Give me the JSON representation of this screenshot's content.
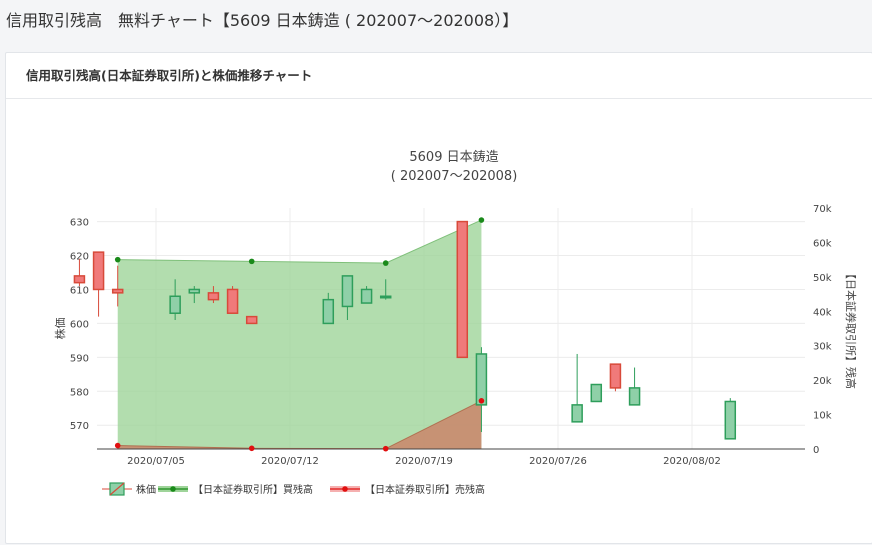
{
  "page": {
    "title": "信用取引残高　無料チャート【5609 日本鋳造 ( 202007～202008）】"
  },
  "card": {
    "header": "信用取引残高(日本証券取引所)と株価推移チャート"
  },
  "colors": {
    "up": "#2e9e5b",
    "up_fill": "#8fd0a8",
    "down": "#d84a3a",
    "down_fill": "#f07a7a",
    "buy_area": "#9fd49a",
    "buy_line": "#1a8a1a",
    "sell_area": "#c98a6e",
    "sell_line": "#e01010",
    "grid": "#ececec",
    "axis_text": "#444"
  },
  "chart_data": {
    "type": "candlestick+area",
    "title": "5609 日本鋳造",
    "subtitle": "( 202007～202008)",
    "y_left_label": "株価",
    "y_right_label": "【日本証券取引所】残高",
    "y_left_ticks": [
      570,
      580,
      590,
      600,
      610,
      620,
      630
    ],
    "y_right_ticks": [
      "0",
      "10k",
      "20k",
      "30k",
      "40k",
      "50k",
      "60k",
      "70k"
    ],
    "y_left_range": [
      563,
      634
    ],
    "y_right_range": [
      0,
      70000
    ],
    "x_ticks": [
      "2020/07/05",
      "2020/07/12",
      "2020/07/19",
      "2020/07/26",
      "2020/08/02"
    ],
    "candles": [
      {
        "date": "2020-07-01",
        "open": 614,
        "high": 619,
        "low": 611,
        "close": 612
      },
      {
        "date": "2020-07-02",
        "open": 621,
        "high": 621,
        "low": 602,
        "close": 610
      },
      {
        "date": "2020-07-03",
        "open": 610,
        "high": 617,
        "low": 605,
        "close": 609
      },
      {
        "date": "2020-07-06",
        "open": 603,
        "high": 613,
        "low": 601,
        "close": 608
      },
      {
        "date": "2020-07-07",
        "open": 609,
        "high": 611,
        "low": 606,
        "close": 610
      },
      {
        "date": "2020-07-08",
        "open": 609,
        "high": 611,
        "low": 606,
        "close": 607
      },
      {
        "date": "2020-07-09",
        "open": 610,
        "high": 611,
        "low": 603,
        "close": 603
      },
      {
        "date": "2020-07-10",
        "open": 602,
        "high": 602,
        "low": 600,
        "close": 600
      },
      {
        "date": "2020-07-14",
        "open": 600,
        "high": 609,
        "low": 600,
        "close": 607
      },
      {
        "date": "2020-07-15",
        "open": 605,
        "high": 614,
        "low": 601,
        "close": 614
      },
      {
        "date": "2020-07-16",
        "open": 606,
        "high": 611,
        "low": 606,
        "close": 610
      },
      {
        "date": "2020-07-17",
        "open": 608,
        "high": 613,
        "low": 607,
        "close": 608
      },
      {
        "date": "2020-07-21",
        "open": 630,
        "high": 630,
        "low": 590,
        "close": 590
      },
      {
        "date": "2020-07-22",
        "open": 576,
        "high": 593,
        "low": 568,
        "close": 591
      },
      {
        "date": "2020-07-27",
        "open": 571,
        "high": 591,
        "low": 571,
        "close": 576
      },
      {
        "date": "2020-07-28",
        "open": 577,
        "high": 582,
        "low": 577,
        "close": 582
      },
      {
        "date": "2020-07-29",
        "open": 588,
        "high": 588,
        "low": 580,
        "close": 581
      },
      {
        "date": "2020-07-30",
        "open": 576,
        "high": 587,
        "low": 576,
        "close": 581
      },
      {
        "date": "2020-08-04",
        "open": 566,
        "high": 578,
        "low": 566,
        "close": 577
      }
    ],
    "series": [
      {
        "name": "【日本証券取引所】買残高",
        "points": [
          {
            "date": "2020-07-03",
            "value": 55000
          },
          {
            "date": "2020-07-10",
            "value": 54500
          },
          {
            "date": "2020-07-17",
            "value": 54000
          },
          {
            "date": "2020-07-22",
            "value": 66500
          }
        ]
      },
      {
        "name": "【日本証券取引所】売残高",
        "points": [
          {
            "date": "2020-07-03",
            "value": 1000
          },
          {
            "date": "2020-07-10",
            "value": 200
          },
          {
            "date": "2020-07-17",
            "value": 100
          },
          {
            "date": "2020-07-22",
            "value": 14000
          }
        ]
      }
    ],
    "legend": [
      {
        "key": "candle",
        "label": "株価"
      },
      {
        "key": "buy",
        "label": "【日本証券取引所】買残高"
      },
      {
        "key": "sell",
        "label": "【日本証券取引所】売残高"
      }
    ],
    "legend_position": "bottom-left",
    "grid": true
  }
}
